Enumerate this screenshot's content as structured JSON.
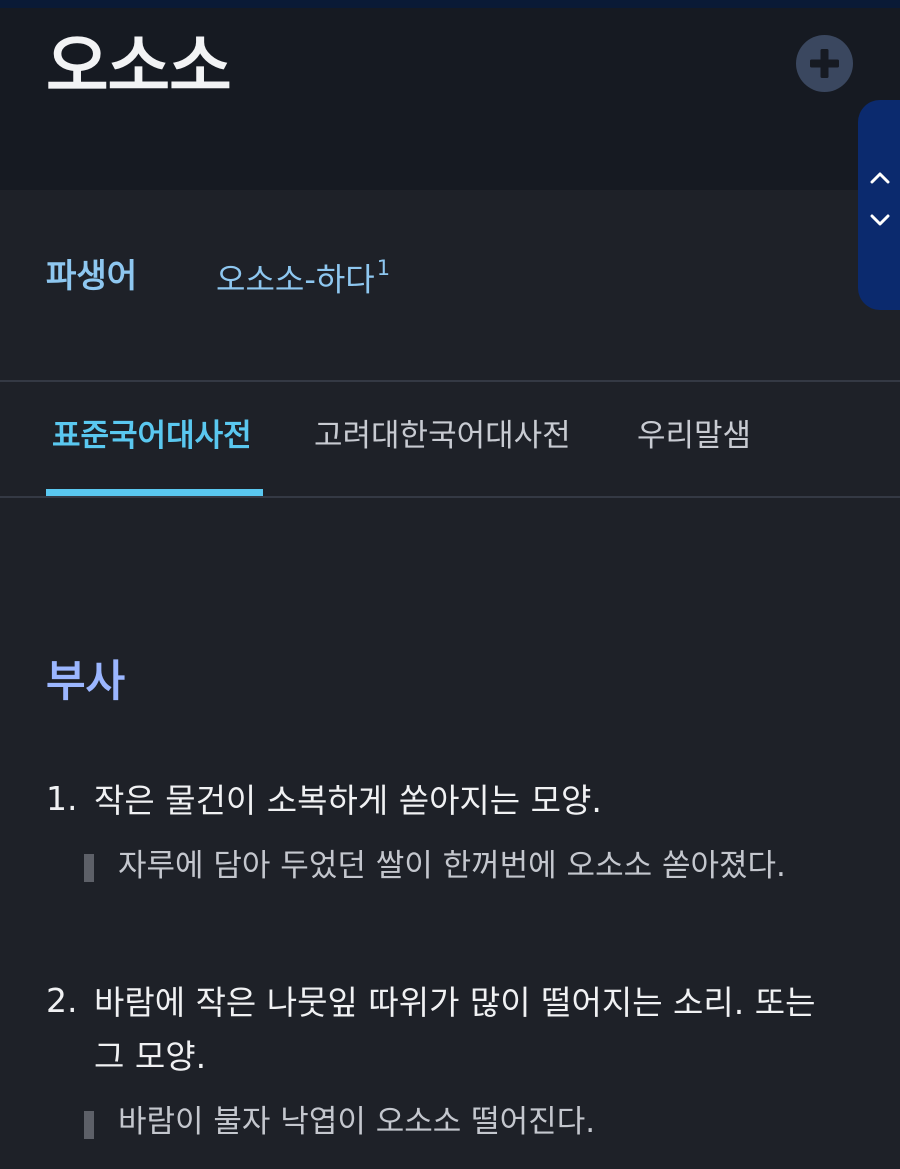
{
  "header": {
    "title": "오소소",
    "add_button_icon": "plus-circle-icon"
  },
  "scroll_panel": {
    "up_icon": "chevron-up-icon",
    "down_icon": "chevron-down-icon"
  },
  "derivative": {
    "label": "파생어",
    "link_text": "오소소-하다",
    "link_superscript": "1"
  },
  "tabs": [
    {
      "label": "표준국어대사전",
      "active": true
    },
    {
      "label": "고려대한국어대사전",
      "active": false
    },
    {
      "label": "우리말샘",
      "active": false
    }
  ],
  "entry": {
    "part_of_speech": "부사",
    "senses": [
      {
        "number": "1.",
        "definition": "작은 물건이 소복하게 쏟아지는 모양.",
        "example": "자루에 담아 두었던 쌀이 한꺼번에 오소소 쏟아졌다."
      },
      {
        "number": "2.",
        "definition": "바람에 작은 나뭇잎 따위가 많이 떨어지는 소리. 또는 그 모양.",
        "example": "바람이 불자 낙엽이 오소소 떨어진다."
      }
    ]
  },
  "colors": {
    "background": "#1e2128",
    "header_background": "#161a22",
    "accent_tab": "#5ac8f0",
    "link": "#8ec7f0",
    "part_of_speech": "#9bb6ff",
    "scroll_panel": "#0b2a6e"
  }
}
